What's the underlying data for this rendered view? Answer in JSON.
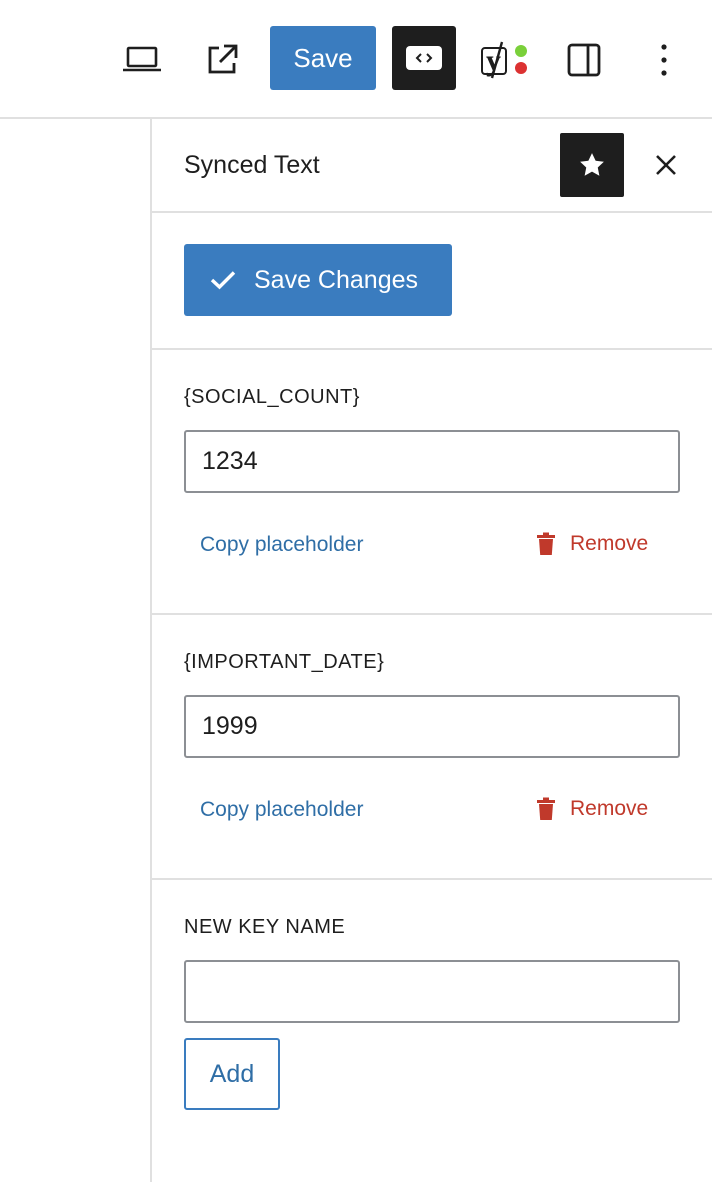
{
  "toolbar": {
    "save_label": "Save",
    "icons": [
      "laptop-icon",
      "external-link-icon",
      "code-block-icon",
      "yoast-icon",
      "sidebar-toggle-icon",
      "more-vertical-icon"
    ]
  },
  "sidebar": {
    "title": "Synced Text",
    "save_changes_label": "Save Changes",
    "keys": [
      {
        "name": "{SOCIAL_COUNT}",
        "value": "1234",
        "copy_label": "Copy placeholder",
        "remove_label": "Remove"
      },
      {
        "name": "{IMPORTANT_DATE}",
        "value": "1999",
        "copy_label": "Copy placeholder",
        "remove_label": "Remove"
      }
    ],
    "new_key": {
      "label": "NEW KEY NAME",
      "value": "",
      "add_label": "Add"
    }
  },
  "colors": {
    "primary": "#3a7cbf",
    "danger": "#c0392b",
    "dark": "#1e1e1e",
    "border": "#e0e0e0"
  }
}
